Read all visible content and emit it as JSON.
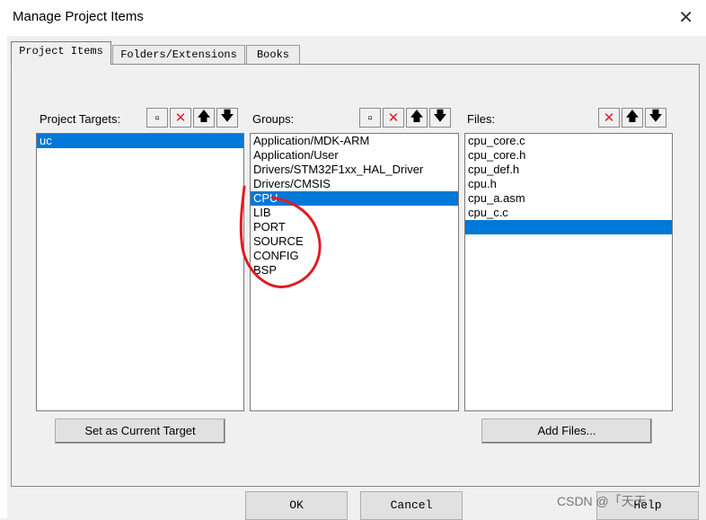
{
  "window": {
    "title": "Manage Project Items",
    "close_icon": "close-icon"
  },
  "tabs": [
    {
      "label": "Project Items"
    },
    {
      "label": "Folders/Extensions"
    },
    {
      "label": "Books"
    }
  ],
  "targets": {
    "label": "Project Targets:",
    "items": [
      "uc"
    ]
  },
  "groups": {
    "label": "Groups:",
    "items": [
      "Application/MDK-ARM",
      "Application/User",
      "Drivers/STM32F1xx_HAL_Driver",
      "Drivers/CMSIS",
      "CPU",
      "LIB",
      "PORT",
      "SOURCE",
      "CONFIG",
      "BSP"
    ]
  },
  "files": {
    "label": "Files:",
    "items": [
      "cpu_core.c",
      "cpu_core.h",
      "cpu_def.h",
      "cpu.h",
      "cpu_a.asm",
      "cpu_c.c"
    ]
  },
  "buttons": {
    "set_current_target": "Set as Current Target",
    "add_files": "Add Files..."
  },
  "bottom": {
    "ok": "OK",
    "cancel": "Cancel",
    "help": "Help"
  },
  "watermark": "CSDN @「天天"
}
